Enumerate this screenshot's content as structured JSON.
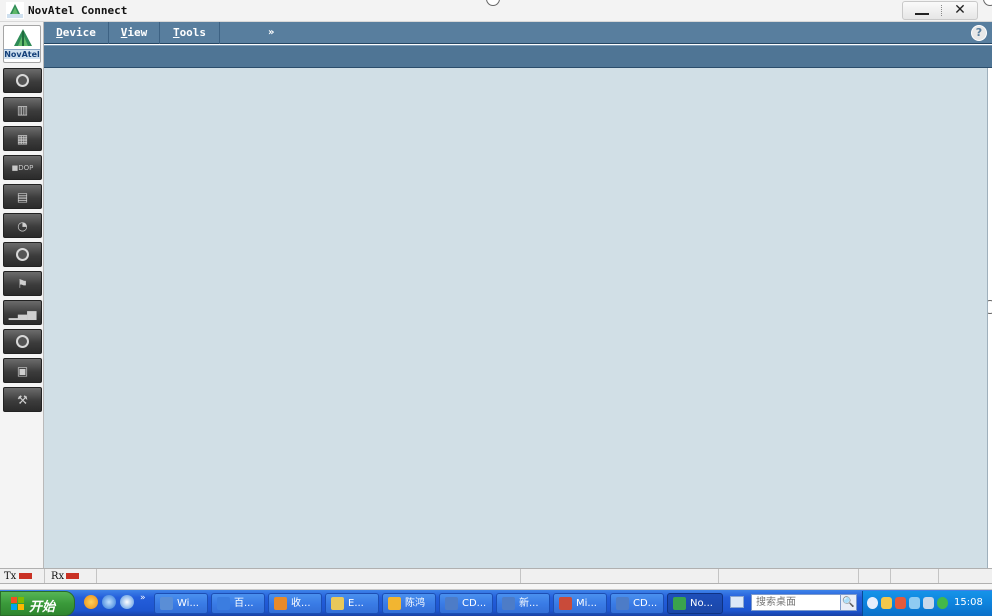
{
  "window": {
    "title": "NovAtel Connect",
    "close_glyph": "✕"
  },
  "brand": {
    "logo_text": "NovAtel"
  },
  "menu": {
    "items": [
      {
        "accel": "D",
        "rest": "evice"
      },
      {
        "accel": "V",
        "rest": "iew"
      },
      {
        "accel": "T",
        "rest": "ools"
      }
    ],
    "overflow": "»",
    "help": "?"
  },
  "toolbar": {
    "icons": [
      "compass-icon",
      "bar-chart-icon",
      "bar-chart-icon",
      "dop-icon",
      "list-view-icon",
      "satellite-dish-icon",
      "circle-gauge-icon",
      "flag-icon",
      "signal-bars-icon",
      "compass-icon",
      "network-icon",
      "settings-wrench-icon"
    ],
    "dop_label": "■DOP"
  },
  "status": {
    "tx_label": "Tx",
    "rx_label": "Rx",
    "indicator_color": "#c93124"
  },
  "taskbar": {
    "start_label": "开始",
    "quicklaunch_more": "»",
    "tasks": [
      {
        "label": "Wi...",
        "color": "#5a8ed6"
      },
      {
        "label": "百...",
        "color": "#3b7de0"
      },
      {
        "label": "收...",
        "color": "#e88a2a"
      },
      {
        "label": "E...",
        "color": "#e9c85a"
      },
      {
        "label": "陈鸿",
        "color": "#f2b531"
      },
      {
        "label": "CD...",
        "color": "#4d7cc7"
      },
      {
        "label": "新...",
        "color": "#4d7cc7"
      },
      {
        "label": "Mi...",
        "color": "#c94b3a"
      },
      {
        "label": "CD...",
        "color": "#4d7cc7"
      },
      {
        "label": "No...",
        "color": "#3aa34d",
        "active": true
      }
    ],
    "search_placeholder": "搜索桌面",
    "search_go": "🔍",
    "clock": "15:08"
  }
}
